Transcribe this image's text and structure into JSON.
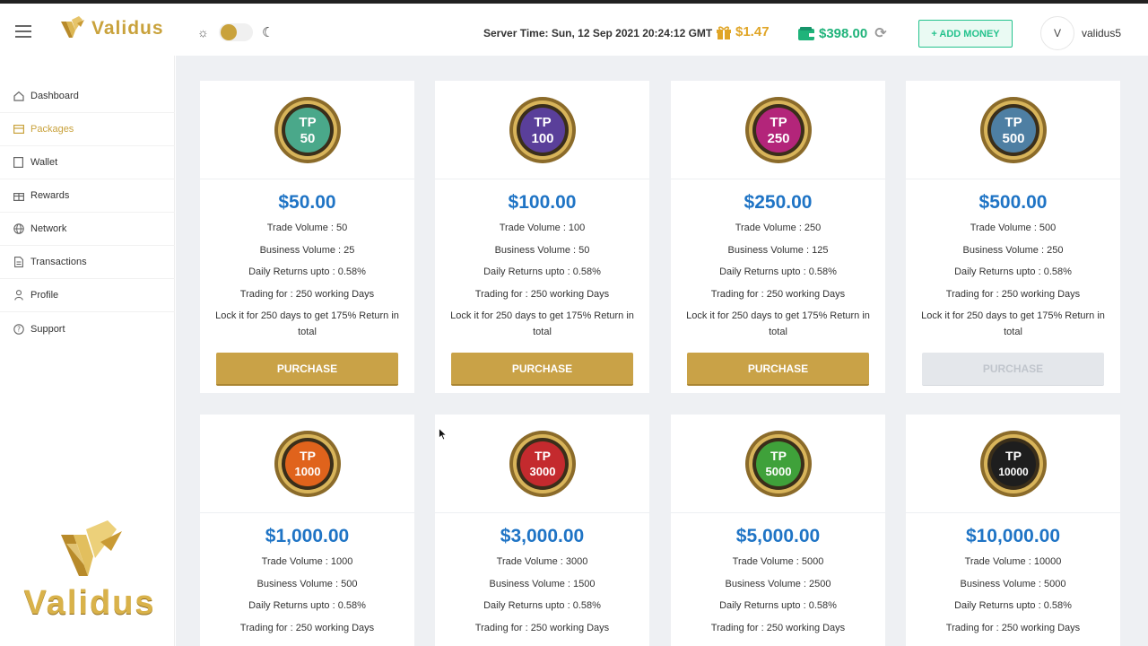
{
  "header": {
    "brand": "Validus",
    "server_time": "Server Time: Sun, 12 Sep 2021 20:24:12 GMT",
    "bonus_balance": "$1.47",
    "wallet_balance": "$398.00",
    "add_money_label": "+ ADD MONEY",
    "avatar_initial": "V",
    "username": "validus5",
    "theme_toggle_state": "light",
    "colors": {
      "brand_gold": "#c9a23c",
      "wallet_green": "#1fb37a",
      "bonus_gold": "#e0a526",
      "price_blue": "#1f74c5"
    }
  },
  "sidebar": {
    "items": [
      {
        "label": "Dashboard",
        "icon": "home-icon",
        "active": false
      },
      {
        "label": "Packages",
        "icon": "packages-icon",
        "active": true
      },
      {
        "label": "Wallet",
        "icon": "wallet-icon",
        "active": false
      },
      {
        "label": "Rewards",
        "icon": "gift-icon",
        "active": false
      },
      {
        "label": "Network",
        "icon": "globe-icon",
        "active": false
      },
      {
        "label": "Transactions",
        "icon": "document-icon",
        "active": false
      },
      {
        "label": "Profile",
        "icon": "user-icon",
        "active": false
      },
      {
        "label": "Support",
        "icon": "help-icon",
        "active": false
      }
    ],
    "logo_text": "Validus"
  },
  "packages": [
    {
      "badge_top": "TP",
      "badge_num": "50",
      "badge_color": "#4aa88a",
      "price": "$50.00",
      "trade_volume": "Trade Volume : 50",
      "business_volume": "Business Volume : 25",
      "daily_returns": "Daily Returns upto : 0.58%",
      "trading_for": "Trading for : 250 working Days",
      "lock_text": "Lock it for 250 days to get 175% Return in total",
      "button": "PURCHASE",
      "disabled": false
    },
    {
      "badge_top": "TP",
      "badge_num": "100",
      "badge_color": "#5a3f9a",
      "price": "$100.00",
      "trade_volume": "Trade Volume : 100",
      "business_volume": "Business Volume : 50",
      "daily_returns": "Daily Returns upto : 0.58%",
      "trading_for": "Trading for : 250 working Days",
      "lock_text": "Lock it for 250 days to get 175% Return in total",
      "button": "PURCHASE",
      "disabled": false
    },
    {
      "badge_top": "TP",
      "badge_num": "250",
      "badge_color": "#b3257a",
      "price": "$250.00",
      "trade_volume": "Trade Volume : 250",
      "business_volume": "Business Volume : 125",
      "daily_returns": "Daily Returns upto : 0.58%",
      "trading_for": "Trading for : 250 working Days",
      "lock_text": "Lock it for 250 days to get 175% Return in total",
      "button": "PURCHASE",
      "disabled": false
    },
    {
      "badge_top": "TP",
      "badge_num": "500",
      "badge_color": "#4e7fa3",
      "price": "$500.00",
      "trade_volume": "Trade Volume : 500",
      "business_volume": "Business Volume : 250",
      "daily_returns": "Daily Returns upto : 0.58%",
      "trading_for": "Trading for : 250 working Days",
      "lock_text": "Lock it for 250 days to get 175% Return in total",
      "button": "PURCHASE",
      "disabled": true
    },
    {
      "badge_top": "TP",
      "badge_num": "1000",
      "badge_color": "#e0631c",
      "price": "$1,000.00",
      "trade_volume": "Trade Volume : 1000",
      "business_volume": "Business Volume : 500",
      "daily_returns": "Daily Returns upto : 0.58%",
      "trading_for": "Trading for : 250 working Days",
      "lock_text": "",
      "button": "",
      "disabled": false
    },
    {
      "badge_top": "TP",
      "badge_num": "3000",
      "badge_color": "#c42a2e",
      "price": "$3,000.00",
      "trade_volume": "Trade Volume : 3000",
      "business_volume": "Business Volume : 1500",
      "daily_returns": "Daily Returns upto : 0.58%",
      "trading_for": "Trading for : 250 working Days",
      "lock_text": "",
      "button": "",
      "disabled": false
    },
    {
      "badge_top": "TP",
      "badge_num": "5000",
      "badge_color": "#3fa13a",
      "price": "$5,000.00",
      "trade_volume": "Trade Volume : 5000",
      "business_volume": "Business Volume : 2500",
      "daily_returns": "Daily Returns upto : 0.58%",
      "trading_for": "Trading for : 250 working Days",
      "lock_text": "",
      "button": "",
      "disabled": false
    },
    {
      "badge_top": "TP",
      "badge_num": "10000",
      "badge_color": "#1e1e1e",
      "price": "$10,000.00",
      "trade_volume": "Trade Volume : 10000",
      "business_volume": "Business Volume : 5000",
      "daily_returns": "Daily Returns upto : 0.58%",
      "trading_for": "Trading for : 250 working Days",
      "lock_text": "",
      "button": "",
      "disabled": false
    }
  ]
}
